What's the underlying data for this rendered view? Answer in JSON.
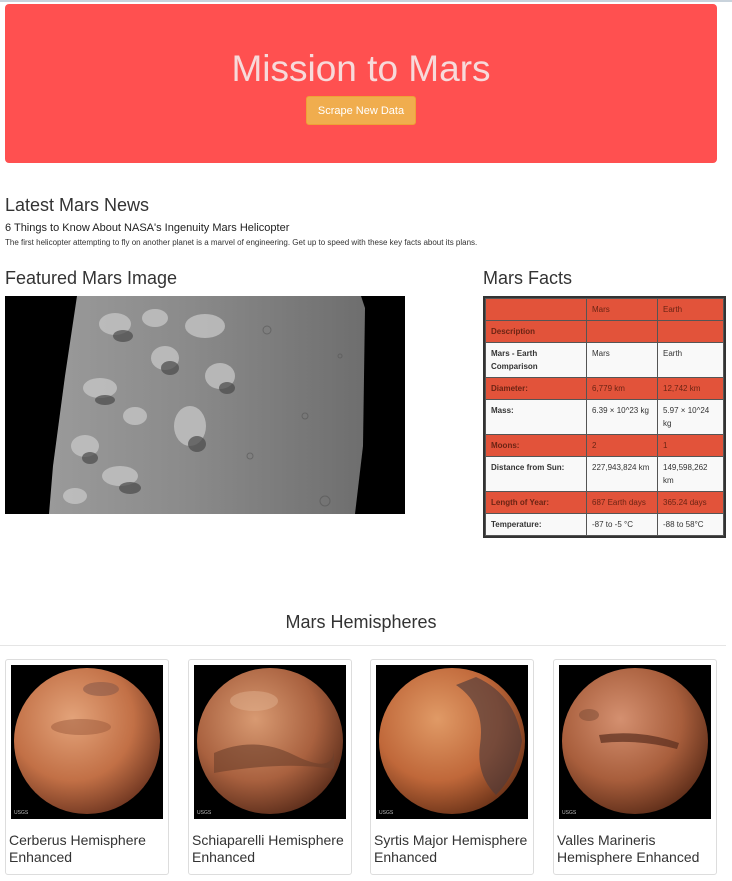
{
  "jumbotron": {
    "title": "Mission to Mars",
    "button_label": "Scrape New Data"
  },
  "news": {
    "section_title": "Latest Mars News",
    "headline": "6 Things to Know About NASA's Ingenuity Mars Helicopter",
    "teaser": "The first helicopter attempting to fly on another planet is a marvel of engineering. Get up to speed with these key facts about its plans."
  },
  "featured": {
    "section_title": "Featured Mars Image"
  },
  "facts": {
    "section_title": "Mars Facts",
    "columns": [
      "",
      "Mars",
      "Earth"
    ],
    "rows": [
      {
        "label": "Description",
        "mars": "",
        "earth": ""
      },
      {
        "label": "Mars - Earth Comparison",
        "mars": "Mars",
        "earth": "Earth"
      },
      {
        "label": "Diameter:",
        "mars": "6,779 km",
        "earth": "12,742 km"
      },
      {
        "label": "Mass:",
        "mars": "6.39 × 10^23 kg",
        "earth": "5.97 × 10^24 kg"
      },
      {
        "label": "Moons:",
        "mars": "2",
        "earth": "1"
      },
      {
        "label": "Distance from Sun:",
        "mars": "227,943,824 km",
        "earth": "149,598,262 km"
      },
      {
        "label": "Length of Year:",
        "mars": "687 Earth days",
        "earth": "365.24 days"
      },
      {
        "label": "Temperature:",
        "mars": "-87 to -5 °C",
        "earth": "-88 to 58°C"
      }
    ]
  },
  "hemispheres": {
    "section_title": "Mars Hemispheres",
    "items": [
      {
        "title": "Cerberus Hemisphere Enhanced",
        "logo": "USGS"
      },
      {
        "title": "Schiaparelli Hemisphere Enhanced",
        "logo": "USGS"
      },
      {
        "title": "Syrtis Major Hemisphere Enhanced",
        "logo": "USGS"
      },
      {
        "title": "Valles Marineris Hemisphere Enhanced",
        "logo": "USGS"
      }
    ]
  },
  "colors": {
    "jumbotron": "#ff5050",
    "button": "#f0ad4e",
    "table_accent": "#e2533a"
  }
}
